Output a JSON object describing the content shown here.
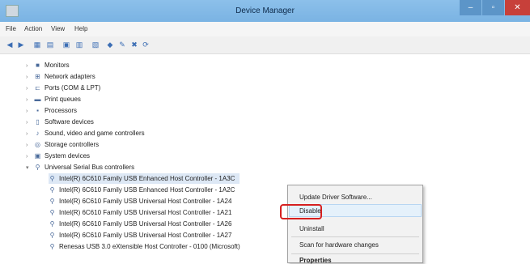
{
  "window": {
    "title": "Device Manager",
    "min": "–",
    "max": "▫",
    "close": "✕"
  },
  "menu": [
    "File",
    "Action",
    "View",
    "Help"
  ],
  "toolbar": [
    "◀",
    "▶",
    "▦",
    "▤",
    "▣",
    "▥",
    "▧",
    "◆",
    "✎",
    "✖",
    "⟳"
  ],
  "tree": [
    {
      "label": "Monitors",
      "icon": "■",
      "expander": "›"
    },
    {
      "label": "Network adapters",
      "icon": "⊞",
      "expander": "›"
    },
    {
      "label": "Ports (COM & LPT)",
      "icon": "⊏",
      "expander": "›"
    },
    {
      "label": "Print queues",
      "icon": "▬",
      "expander": "›"
    },
    {
      "label": "Processors",
      "icon": "▪",
      "expander": "›"
    },
    {
      "label": "Software devices",
      "icon": "▯",
      "expander": "›"
    },
    {
      "label": "Sound, video and game controllers",
      "icon": "♪",
      "expander": "›"
    },
    {
      "label": "Storage controllers",
      "icon": "◎",
      "expander": "›"
    },
    {
      "label": "System devices",
      "icon": "▣",
      "expander": "›"
    },
    {
      "label": "Universal Serial Bus controllers",
      "icon": "⚲",
      "expander": "▾"
    }
  ],
  "usb_children": [
    "Intel(R) 6C610 Family USB Enhanced Host Controller - 1A3C",
    "Intel(R) 6C610 Family USB Enhanced Host Controller - 1A2C",
    "Intel(R) 6C610 Family USB Universal Host Controller - 1A24",
    "Intel(R) 6C610 Family USB Universal Host Controller - 1A21",
    "Intel(R) 6C610 Family USB Universal Host Controller - 1A26",
    "Intel(R) 6C610 Family USB Universal Host Controller - 1A27",
    "Renesas USB 3.0 eXtensible Host Controller - 0100 (Microsoft)"
  ],
  "context_menu": {
    "update": "Update Driver Software...",
    "disable": "Disable",
    "uninstall": "Uninstall",
    "scan": "Scan for hardware changes",
    "properties": "Properties"
  }
}
